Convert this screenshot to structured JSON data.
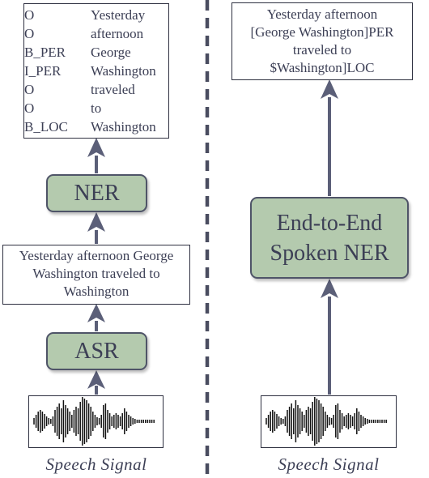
{
  "pipeline": {
    "tag_output": [
      {
        "tag": "O",
        "word": "Yesterday"
      },
      {
        "tag": "O",
        "word": "afternoon"
      },
      {
        "tag": "B_PER",
        "word": "George"
      },
      {
        "tag": "I_PER",
        "word": "Washington"
      },
      {
        "tag": "O",
        "word": "traveled"
      },
      {
        "tag": "O",
        "word": "to"
      },
      {
        "tag": "B_LOC",
        "word": "Washington"
      }
    ],
    "ner_label": "NER",
    "transcript": "Yesterday afternoon George Washington traveled to Washington",
    "asr_label": "ASR",
    "input_caption": "Speech Signal"
  },
  "end_to_end": {
    "output_lines": [
      "Yesterday afternoon",
      "[George Washington]PER",
      "traveled to",
      "$Washington]LOC"
    ],
    "model_label_lines": [
      "End-to-End",
      "Spoken NER"
    ],
    "input_caption": "Speech Signal"
  },
  "colors": {
    "module_fill": "#b4caae",
    "arrow": "#5b5f78",
    "divider": "#4a4d60"
  }
}
